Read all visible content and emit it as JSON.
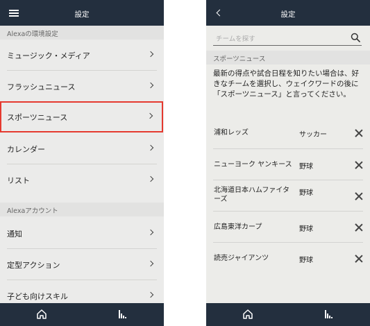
{
  "left": {
    "header": {
      "title": "設定"
    },
    "sections": [
      {
        "title": "Alexaの環境設定",
        "items": [
          {
            "label": "ミュージック・メディア"
          },
          {
            "label": "フラッシュニュース"
          },
          {
            "label": "スポーツニュース",
            "highlighted": true
          },
          {
            "label": "カレンダー"
          },
          {
            "label": "リスト"
          }
        ]
      },
      {
        "title": "Alexaアカウント",
        "items": [
          {
            "label": "通知"
          },
          {
            "label": "定型アクション"
          },
          {
            "label": "子ども向けスキル"
          }
        ]
      }
    ],
    "bottom_nav": [
      "home-icon",
      "activity-icon"
    ]
  },
  "right": {
    "header": {
      "title": "設定"
    },
    "search": {
      "placeholder": "チームを探す",
      "value": ""
    },
    "section_title": "スポーツニュース",
    "description": "最新の得点や試合日程を知りたい場合は、好きなチームを選択し、ウェイクワードの後に「スポーツニュース」と言ってください。",
    "teams": [
      {
        "name": "浦和レッズ",
        "sport": "サッカー"
      },
      {
        "name": "ニューヨーク ヤンキース",
        "sport": "野球"
      },
      {
        "name": "北海道日本ハムファイターズ",
        "sport": "野球"
      },
      {
        "name": "広島東洋カープ",
        "sport": "野球"
      },
      {
        "name": "読売ジャイアンツ",
        "sport": "野球"
      }
    ],
    "bottom_nav": [
      "home-icon",
      "activity-icon"
    ]
  },
  "colors": {
    "topbar": "#232f3e",
    "highlight": "#e5392f",
    "background": "#ebebea"
  }
}
